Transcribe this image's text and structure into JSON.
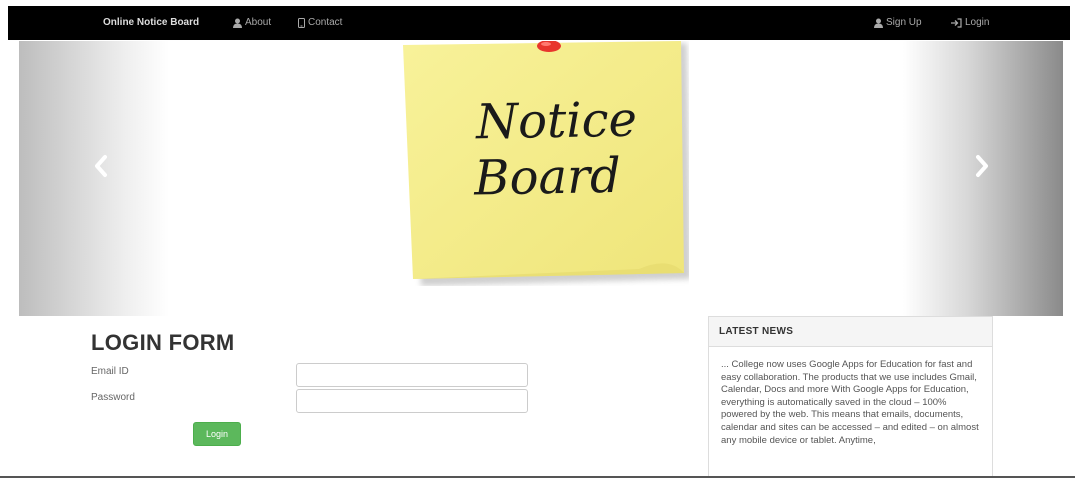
{
  "navbar": {
    "brand": "Online Notice Board",
    "about": "About",
    "contact": "Contact",
    "signup": "Sign Up",
    "login": "Login"
  },
  "carousel": {
    "note_line1": "Notice",
    "note_line2": "Board"
  },
  "login_form": {
    "title": "LOGIN FORM",
    "email_label": "Email ID",
    "password_label": "Password",
    "button": "Login"
  },
  "news": {
    "title": "LATEST NEWS",
    "body": "... College now uses Google Apps for Education for fast and easy collaboration. The products that we use includes Gmail, Calendar, Docs and more With Google Apps for Education, everything is automatically saved in the cloud – 100% powered by the web. This means that emails, documents, calendar and sites can be accessed – and edited – on almost any mobile device or tablet. Anytime,"
  },
  "colors": {
    "navbar_bg": "#000000",
    "login_button": "#5cb85c",
    "sticky_note": "#f6ef8a",
    "pin": "#e8352c"
  },
  "icons": [
    "user-icon",
    "phone-icon",
    "login-icon",
    "chevron-left-icon",
    "chevron-right-icon",
    "pushpin-icon"
  ]
}
